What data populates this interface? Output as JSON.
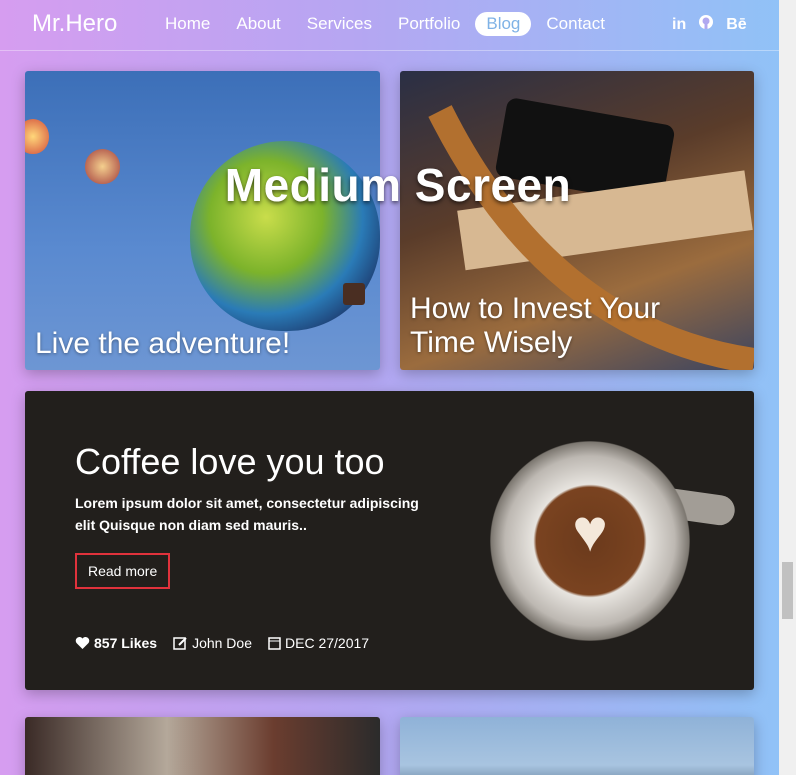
{
  "nav": {
    "brand": "Mr.Hero",
    "items": [
      {
        "label": "Home"
      },
      {
        "label": "About"
      },
      {
        "label": "Services"
      },
      {
        "label": "Portfolio"
      },
      {
        "label": "Blog",
        "active": true
      },
      {
        "label": "Contact"
      }
    ],
    "social": [
      "in",
      "github-icon",
      "Bē"
    ]
  },
  "overlay": "Medium Screen",
  "cards": {
    "c1_title": "Live the adventure!",
    "c2_title": "How to Invest Your Time Wisely",
    "featured": {
      "title": "Coffee love you too",
      "text": "Lorem ipsum dolor sit amet, consectetur adipiscing elit Quisque non diam sed mauris..",
      "button": "Read more",
      "likes": "857 Likes",
      "author": "John Doe",
      "date": "DEC 27/2017"
    }
  },
  "colors": {
    "accent": "#e0323c",
    "active_nav_text": "#7fb2e6"
  }
}
